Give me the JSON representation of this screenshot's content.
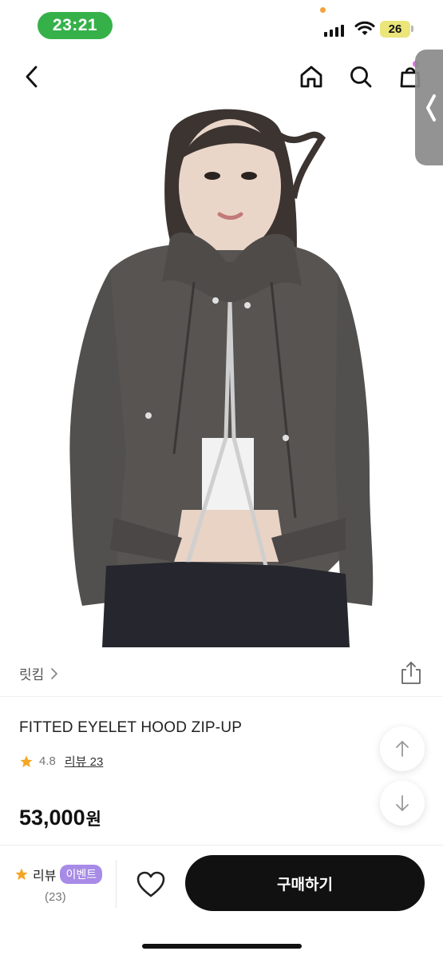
{
  "status_bar": {
    "time": "23:21",
    "battery": "26"
  },
  "nav": {
    "back_icon": "chevron-left-icon",
    "home_icon": "home-icon",
    "search_icon": "search-icon",
    "bag_icon": "shopping-bag-icon"
  },
  "product": {
    "brand": "릿킴",
    "title": "FITTED EYELET HOOD ZIP-UP",
    "rating": "4.8",
    "review_link": "리뷰 23",
    "price": "53,000",
    "price_unit": "원"
  },
  "bottom_bar": {
    "review_label": "리뷰",
    "event_badge": "이벤트",
    "review_count": "(23)",
    "buy_label": "구매하기"
  },
  "colors": {
    "time_pill": "#36b14a",
    "star": "#f5a623",
    "event_badge": "#a78be6",
    "buy_button": "#111111"
  }
}
